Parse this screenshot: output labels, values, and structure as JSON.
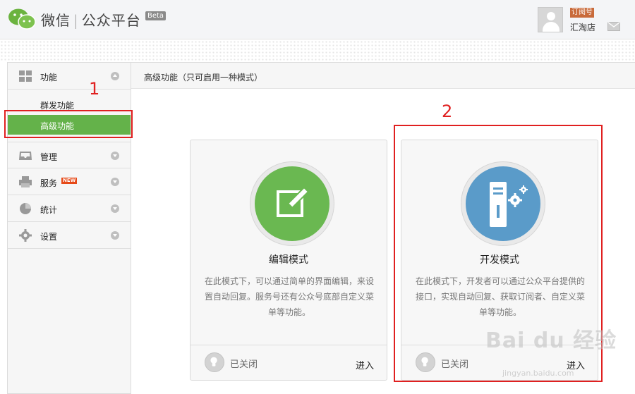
{
  "header": {
    "brand_left": "微信",
    "brand_right": "公众平台",
    "beta": "Beta",
    "account_type": "订阅号",
    "account_name": "汇淘店"
  },
  "sidebar": {
    "items": [
      {
        "label": "功能"
      },
      {
        "label": "群发功能"
      },
      {
        "label": "高级功能"
      },
      {
        "label": "管理"
      },
      {
        "label": "服务"
      },
      {
        "label": "统计"
      },
      {
        "label": "设置"
      }
    ],
    "new_badge": "NEW"
  },
  "annotations": {
    "one": "1",
    "two": "2"
  },
  "content": {
    "title": "高级功能（只可启用一种模式）",
    "cards": [
      {
        "name": "编辑模式",
        "desc": "在此模式下，可以通过简单的界面编辑，来设置自动回复。服务号还有公众号底部自定义菜单等功能。",
        "status": "已关闭",
        "enter": "进入"
      },
      {
        "name": "开发模式",
        "desc": "在此模式下，开发者可以通过公众平台提供的接口，实现自动回复、获取订阅者、自定义菜单等功能。",
        "status": "已关闭",
        "enter": "进入"
      }
    ]
  },
  "watermark": {
    "main": "Bai du 经验",
    "sub": "jingyan.baidu.com"
  },
  "colors": {
    "active_green": "#64b24a",
    "edit_green": "#6ab851",
    "dev_blue": "#5a9bc9",
    "annotation_red": "#e02020"
  }
}
